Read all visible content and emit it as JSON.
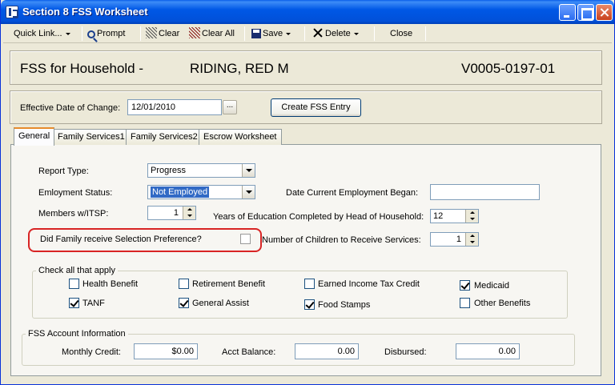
{
  "window": {
    "title": "Section 8 FSS Worksheet"
  },
  "toolbar": {
    "quick_link": "Quick Link...",
    "prompt": "Prompt",
    "clear": "Clear",
    "clear_all": "Clear All",
    "save": "Save",
    "delete": "Delete",
    "close": "Close"
  },
  "household": {
    "label": "FSS for Household -",
    "name": "RIDING, RED M",
    "id": "V0005-0197-01"
  },
  "effective": {
    "label": "Effective Date of Change:",
    "value": "12/01/2010",
    "browse": "...",
    "create_button": "Create FSS Entry"
  },
  "tabs": [
    "General",
    "Family Services1",
    "Family Services2",
    "Escrow Worksheet"
  ],
  "general": {
    "report_type_label": "Report Type:",
    "report_type_value": "Progress",
    "employment_label": "Emloyment Status:",
    "employment_value": "Not Employed",
    "date_employment_label": "Date Current Employment Began:",
    "date_employment_value": "",
    "members_label": "Members w/ITSP:",
    "members_value": "1",
    "education_label": "Years of Education Completed by Head of Household:",
    "education_value": "12",
    "selection_pref_label": "Did Family receive Selection Preference?",
    "children_label": "Number of Children to Receive Services:",
    "children_value": "1"
  },
  "check_group": {
    "title": "Check all that apply",
    "items": [
      {
        "label": "Health Benefit",
        "checked": false
      },
      {
        "label": "Retirement Benefit",
        "checked": false
      },
      {
        "label": "Earned Income Tax Credit",
        "checked": false
      },
      {
        "label": "Medicaid",
        "checked": true
      },
      {
        "label": "TANF",
        "checked": true
      },
      {
        "label": "General Assist",
        "checked": true
      },
      {
        "label": "Food Stamps",
        "checked": true
      },
      {
        "label": "Other Benefits",
        "checked": false
      }
    ]
  },
  "account": {
    "title": "FSS Account Information",
    "monthly_credit_label": "Monthly Credit:",
    "monthly_credit_value": "$0.00",
    "acct_balance_label": "Acct Balance:",
    "acct_balance_value": "0.00",
    "disbursed_label": "Disbursed:",
    "disbursed_value": "0.00"
  }
}
